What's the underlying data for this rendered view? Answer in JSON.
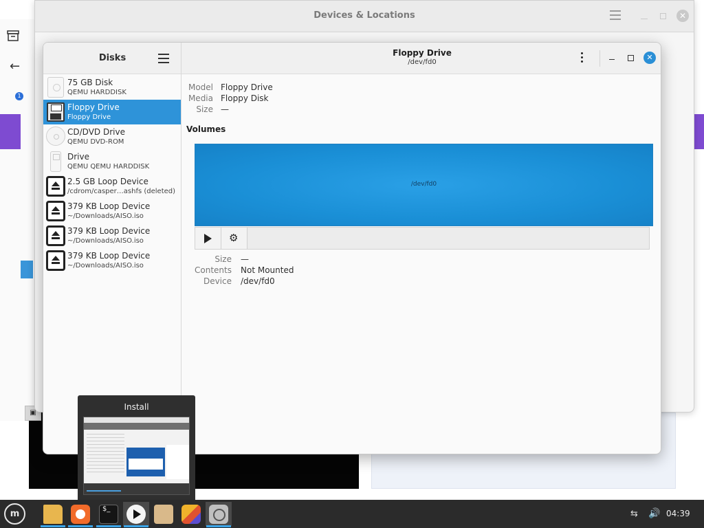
{
  "background_window": {
    "title": "Devices & Locations"
  },
  "disks_window": {
    "sidebar_title": "Disks",
    "header_title": "Floppy Drive",
    "header_subtitle": "/dev/fd0",
    "selected_index": 1,
    "disks": [
      {
        "name": "75 GB Disk",
        "sub": "QEMU HARDDISK",
        "icon": "hard-disk-icon"
      },
      {
        "name": "Floppy Drive",
        "sub": "Floppy Drive",
        "icon": "floppy-icon"
      },
      {
        "name": "CD/DVD Drive",
        "sub": "QEMU DVD-ROM",
        "icon": "optical-disc-icon"
      },
      {
        "name": "Drive",
        "sub": "QEMU QEMU HARDDISK",
        "icon": "usb-drive-icon"
      },
      {
        "name": "2.5 GB Loop Device",
        "sub": "/cdrom/casper…ashfs (deleted)",
        "icon": "eject-icon"
      },
      {
        "name": "379 KB Loop Device",
        "sub": "~/Downloads/AISO.iso",
        "icon": "eject-icon"
      },
      {
        "name": "379 KB Loop Device",
        "sub": "~/Downloads/AISO.iso",
        "icon": "eject-icon"
      },
      {
        "name": "379 KB Loop Device",
        "sub": "~/Downloads/AISO.iso",
        "icon": "eject-icon"
      }
    ],
    "details": {
      "model_label": "Model",
      "model_value": "Floppy Drive",
      "media_label": "Media",
      "media_value": "Floppy Disk",
      "size_label": "Size",
      "size_value": "—"
    },
    "volumes": {
      "title": "Volumes",
      "bar_label": "/dev/fd0",
      "size_label": "Size",
      "size_value": "—",
      "contents_label": "Contents",
      "contents_value": "Not Mounted",
      "device_label": "Device",
      "device_value": "/dev/fd0"
    }
  },
  "preview_popup": {
    "title": "Install"
  },
  "taskbar": {
    "clock": "04:39",
    "accent_color": "#3aa4e8",
    "apps": [
      "files-icon",
      "firefox-icon",
      "terminal-icon",
      "install-icon",
      "archive-icon",
      "shapes-icon",
      "disks-icon"
    ]
  },
  "colors": {
    "selection": "#2e93d9",
    "volume_fill": "#1a8fd6"
  }
}
